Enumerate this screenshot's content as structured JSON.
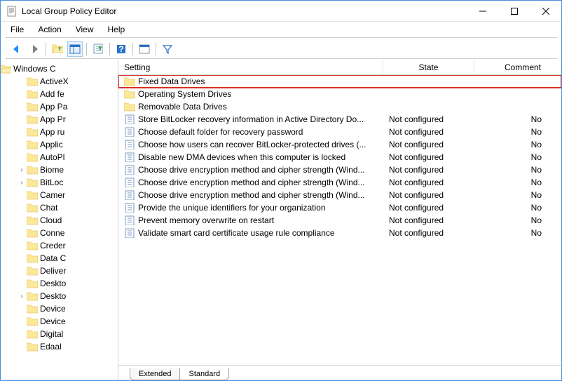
{
  "window": {
    "title": "Local Group Policy Editor"
  },
  "menus": [
    "File",
    "Action",
    "View",
    "Help"
  ],
  "tree": {
    "root": {
      "label": "Windows C",
      "expanded": true
    },
    "children": [
      {
        "label": "ActiveX",
        "expandable": false
      },
      {
        "label": "Add fe",
        "expandable": false
      },
      {
        "label": "App Pa",
        "expandable": false
      },
      {
        "label": "App Pr",
        "expandable": false
      },
      {
        "label": "App ru",
        "expandable": false
      },
      {
        "label": "Applic",
        "expandable": false
      },
      {
        "label": "AutoPl",
        "expandable": false
      },
      {
        "label": "Biome",
        "expandable": true
      },
      {
        "label": "BitLoc",
        "expandable": true
      },
      {
        "label": "Camer",
        "expandable": false
      },
      {
        "label": "Chat",
        "expandable": false
      },
      {
        "label": "Cloud",
        "expandable": false
      },
      {
        "label": "Conne",
        "expandable": false
      },
      {
        "label": "Creder",
        "expandable": false
      },
      {
        "label": "Data C",
        "expandable": false
      },
      {
        "label": "Deliver",
        "expandable": false
      },
      {
        "label": "Deskto",
        "expandable": false
      },
      {
        "label": "Deskto",
        "expandable": true
      },
      {
        "label": "Device",
        "expandable": false
      },
      {
        "label": "Device",
        "expandable": false
      },
      {
        "label": "Digital",
        "expandable": false
      },
      {
        "label": "Edaal",
        "expandable": false
      }
    ]
  },
  "columns": {
    "setting": "Setting",
    "state": "State",
    "comment": "Comment"
  },
  "rows": [
    {
      "type": "folder",
      "setting": "Fixed Data Drives",
      "state": "",
      "comment": "",
      "highlight": true
    },
    {
      "type": "folder",
      "setting": "Operating System Drives",
      "state": "",
      "comment": ""
    },
    {
      "type": "folder",
      "setting": "Removable Data Drives",
      "state": "",
      "comment": ""
    },
    {
      "type": "policy",
      "setting": "Store BitLocker recovery information in Active Directory Do...",
      "state": "Not configured",
      "comment": "No"
    },
    {
      "type": "policy",
      "setting": "Choose default folder for recovery password",
      "state": "Not configured",
      "comment": "No"
    },
    {
      "type": "policy",
      "setting": "Choose how users can recover BitLocker-protected drives (...",
      "state": "Not configured",
      "comment": "No"
    },
    {
      "type": "policy",
      "setting": "Disable new DMA devices when this computer is locked",
      "state": "Not configured",
      "comment": "No"
    },
    {
      "type": "policy",
      "setting": "Choose drive encryption method and cipher strength (Wind...",
      "state": "Not configured",
      "comment": "No"
    },
    {
      "type": "policy",
      "setting": "Choose drive encryption method and cipher strength (Wind...",
      "state": "Not configured",
      "comment": "No"
    },
    {
      "type": "policy",
      "setting": "Choose drive encryption method and cipher strength (Wind...",
      "state": "Not configured",
      "comment": "No"
    },
    {
      "type": "policy",
      "setting": "Provide the unique identifiers for your organization",
      "state": "Not configured",
      "comment": "No"
    },
    {
      "type": "policy",
      "setting": "Prevent memory overwrite on restart",
      "state": "Not configured",
      "comment": "No"
    },
    {
      "type": "policy",
      "setting": "Validate smart card certificate usage rule compliance",
      "state": "Not configured",
      "comment": "No"
    }
  ],
  "tabs": {
    "extended": "Extended",
    "standard": "Standard",
    "active": "standard"
  }
}
